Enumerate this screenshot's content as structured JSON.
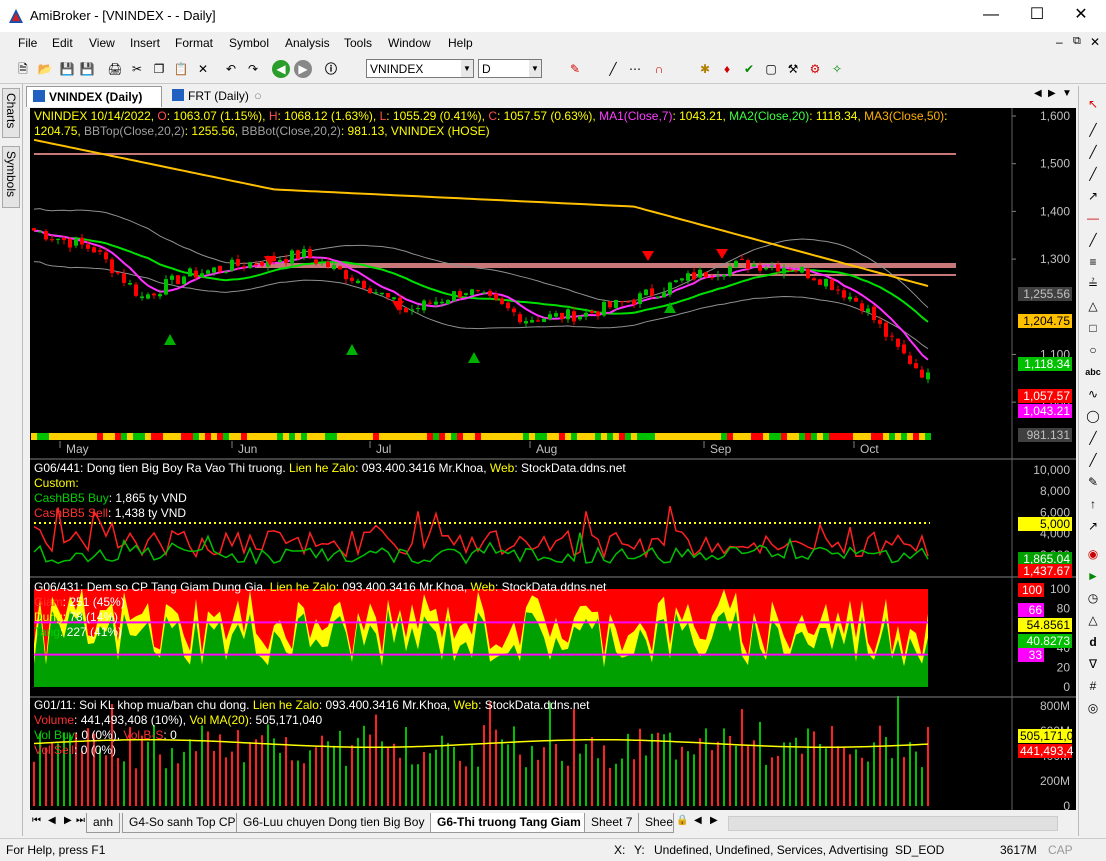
{
  "window": {
    "title": "AmiBroker - [VNINDEX -  - Daily]"
  },
  "menu": [
    "File",
    "Edit",
    "View",
    "Insert",
    "Format",
    "Symbol",
    "Analysis",
    "Tools",
    "Window",
    "Help"
  ],
  "toolbar": {
    "symbol": "VNINDEX",
    "interval": "D"
  },
  "side_tabs": [
    "Charts",
    "Symbols"
  ],
  "doc_tabs": [
    {
      "label": "VNINDEX (Daily)",
      "active": true
    },
    {
      "label": "FRT (Daily)",
      "active": false
    }
  ],
  "sheet_tabs": [
    "anh",
    "G4-So sanh Top CP",
    "G6-Luu chuyen Dong tien Big Boy",
    "G6-Thi truong Tang Giam",
    "Sheet 7",
    "Sheet"
  ],
  "active_sheet": "G6-Thi truong Tang Giam",
  "status": {
    "help": "For Help, press F1",
    "x": "X:",
    "y": "Y:",
    "info": "Undefined, Undefined, Services, Advertising",
    "db": "SD_EOD",
    "mem": "3617M",
    "cap": "CAP"
  },
  "pane1": {
    "header_line1": [
      {
        "t": "VNINDEX 10/14/2022, ",
        "c": "#ffff00"
      },
      {
        "t": "O",
        "c": "#ff5050"
      },
      {
        "t": ": 1063.07 (1.15%), ",
        "c": "#ffff00"
      },
      {
        "t": "H",
        "c": "#ff5050"
      },
      {
        "t": ": 1068.12 (1.63%), ",
        "c": "#ffff00"
      },
      {
        "t": "L",
        "c": "#ff5050"
      },
      {
        "t": ": 1055.29 (0.41%), ",
        "c": "#ffff00"
      },
      {
        "t": "C",
        "c": "#ff5050"
      },
      {
        "t": ": 1057.57 (0.63%), ",
        "c": "#ffff00"
      },
      {
        "t": "MA1(Close,7)",
        "c": "#ff40ff"
      },
      {
        "t": ": 1043.21, ",
        "c": "#ffff00"
      },
      {
        "t": "MA2(Close,20)",
        "c": "#40ff40"
      },
      {
        "t": ": 1118.34, ",
        "c": "#ffff00"
      },
      {
        "t": "MA3(Close,50)",
        "c": "#ffb000"
      },
      {
        "t": ":",
        "c": "#ffff00"
      }
    ],
    "header_line2": [
      {
        "t": "1204.75, ",
        "c": "#ffff00"
      },
      {
        "t": "BBTop(Close,20,2)",
        "c": "#a0a0a0"
      },
      {
        "t": ": 1255.56, ",
        "c": "#ffff00"
      },
      {
        "t": "BBBot(Close,20,2)",
        "c": "#a0a0a0"
      },
      {
        "t": ": 981.13, ",
        "c": "#ffff00"
      },
      {
        "t": "VNINDEX (HOSE)",
        "c": "#ffff00"
      }
    ],
    "y_ticks": [
      "1,600",
      "1,500",
      "1,400",
      "1,300",
      "1,100",
      "1,000"
    ],
    "x_labels": [
      "May",
      "Jun",
      "Jul",
      "Aug",
      "Sep",
      "Oct"
    ],
    "right_labels": [
      {
        "t": "1,255.56",
        "bg": "#404040",
        "fg": "#c0c0c0"
      },
      {
        "t": "1,204.75",
        "bg": "#ffc000",
        "fg": "#000"
      },
      {
        "t": "1,118.34",
        "bg": "#00c000",
        "fg": "#fff"
      },
      {
        "t": "1,057.57",
        "bg": "#ff0000",
        "fg": "#fff"
      },
      {
        "t": "1,043.21",
        "bg": "#ff00ff",
        "fg": "#fff"
      },
      {
        "t": "981.131",
        "bg": "#404040",
        "fg": "#c0c0c0"
      }
    ]
  },
  "pane2": {
    "title": [
      {
        "t": "G06/441: Dong tien Big Boy Ra Vao Thi truong. ",
        "c": "#fff"
      },
      {
        "t": "Lien he Zalo",
        "c": "#ffff00"
      },
      {
        "t": ": 093.400.3416 Mr.Khoa, ",
        "c": "#fff"
      },
      {
        "t": "Web",
        "c": "#ffff00"
      },
      {
        "t": ": StockData.ddns.net",
        "c": "#fff"
      }
    ],
    "custom": "Custom:",
    "buy": [
      {
        "t": "CashBB5 Buy",
        "c": "#00d000"
      },
      {
        "t": ": 1,865 ty VND",
        "c": "#fff"
      }
    ],
    "sell": [
      {
        "t": "CashBB5 Sell",
        "c": "#ff3030"
      },
      {
        "t": ": 1,438 ty VND",
        "c": "#fff"
      }
    ],
    "y_ticks": [
      "10,000",
      "8,000",
      "6,000",
      "4,000",
      "2,000"
    ],
    "right_labels": [
      {
        "t": "5,000",
        "bg": "#ffff00",
        "fg": "#000"
      },
      {
        "t": "1,865.04",
        "bg": "#00a000",
        "fg": "#fff"
      },
      {
        "t": "1,437.67",
        "bg": "#ff0000",
        "fg": "#fff"
      }
    ]
  },
  "pane3": {
    "title": [
      {
        "t": "G06/431: Dem so CP Tang Giam Dung Gia. ",
        "c": "#fff"
      },
      {
        "t": "Lien he Zalo",
        "c": "#ffff00"
      },
      {
        "t": ": 093.400.3416 Mr.Khoa, ",
        "c": "#fff"
      },
      {
        "t": "Web",
        "c": "#ffff00"
      },
      {
        "t": ": StockData.ddns.net",
        "c": "#fff"
      }
    ],
    "giam": [
      {
        "t": "Giam",
        "c": "#ff3030"
      },
      {
        "t": ": 251 (45%)",
        "c": "#fff"
      }
    ],
    "dung": [
      {
        "t": "Dung",
        "c": "#ffff00"
      },
      {
        "t": ": 78 (14%)",
        "c": "#fff"
      }
    ],
    "tang": [
      {
        "t": "Tang",
        "c": "#00d000"
      },
      {
        "t": ": 227 (41%)",
        "c": "#fff"
      }
    ],
    "y_ticks": [
      "100",
      "80",
      "60",
      "40",
      "20",
      "0"
    ],
    "right_labels": [
      {
        "t": "100",
        "bg": "#ff0000",
        "fg": "#fff"
      },
      {
        "t": "66",
        "bg": "#ff00ff",
        "fg": "#fff"
      },
      {
        "t": "54.8561",
        "bg": "#ffff00",
        "fg": "#000"
      },
      {
        "t": "40.8273",
        "bg": "#00c000",
        "fg": "#fff"
      },
      {
        "t": "33",
        "bg": "#ff00ff",
        "fg": "#fff"
      }
    ]
  },
  "pane4": {
    "title": [
      {
        "t": "G01/11: Soi KL khop mua/ban chu dong. ",
        "c": "#fff"
      },
      {
        "t": "Lien he Zalo",
        "c": "#ffff00"
      },
      {
        "t": ": 093.400.3416 Mr.Khoa, ",
        "c": "#fff"
      },
      {
        "t": "Web",
        "c": "#ffff00"
      },
      {
        "t": ": StockData.ddns.net",
        "c": "#fff"
      }
    ],
    "volume": [
      {
        "t": "Volume",
        "c": "#ff3030"
      },
      {
        "t": ": 441,493,408 (10%), ",
        "c": "#fff"
      },
      {
        "t": "Vol MA(20)",
        "c": "#ffff00"
      },
      {
        "t": ": 505,171,040",
        "c": "#fff"
      }
    ],
    "volbuy": [
      {
        "t": "Vol Buy",
        "c": "#00d000"
      },
      {
        "t": ":                 0 (0%), ",
        "c": "#fff"
      },
      {
        "t": "Vol B-S",
        "c": "#ff3030"
      },
      {
        "t": ": 0",
        "c": "#fff"
      }
    ],
    "volsell": [
      {
        "t": "Vol Sell",
        "c": "#ff3030"
      },
      {
        "t": ":                0 (0%)",
        "c": "#fff"
      }
    ],
    "y_ticks": [
      "800M",
      "600M",
      "400M",
      "200M",
      "0"
    ],
    "right_labels": [
      {
        "t": "505,171,0",
        "bg": "#ffff00",
        "fg": "#000"
      },
      {
        "t": "441,493,4",
        "bg": "#ff0000",
        "fg": "#fff"
      }
    ]
  }
}
